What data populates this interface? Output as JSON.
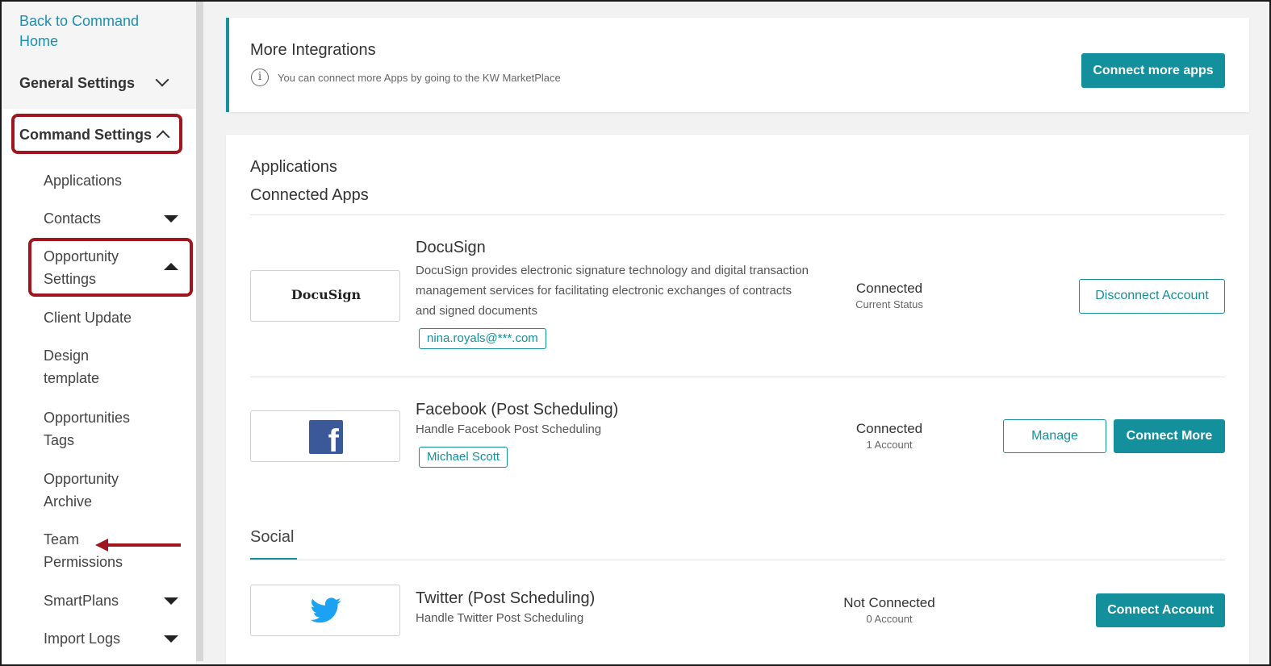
{
  "sidebar": {
    "back_link": "Back to Command Home",
    "general_settings": "General Settings",
    "command_settings": "Command Settings",
    "items": [
      {
        "label": "Applications"
      },
      {
        "label": "Contacts"
      },
      {
        "label": "Opportunity Settings"
      },
      {
        "label": "Client Update"
      },
      {
        "label": "Design template"
      },
      {
        "label": "Opportunities Tags"
      },
      {
        "label": "Opportunity Archive"
      },
      {
        "label": "Team Permissions"
      },
      {
        "label": "SmartPlans"
      },
      {
        "label": "Import Logs"
      }
    ]
  },
  "integrations": {
    "title": "More Integrations",
    "hint": "You can connect more Apps by going to the KW MarketPlace",
    "button": "Connect more apps"
  },
  "applications": {
    "title": "Applications",
    "subtitle": "Connected Apps",
    "apps": [
      {
        "name": "DocuSign",
        "logo_text": "DocuSign",
        "description": "DocuSign provides electronic signature technology and digital transaction management services for facilitating electronic exchanges of contracts and signed documents",
        "account": "nina.royals@***.com",
        "status": "Connected",
        "status_sub": "Current Status",
        "action": "Disconnect Account"
      },
      {
        "name": "Facebook (Post Scheduling)",
        "logo_text": "f",
        "description": "Handle Facebook Post Scheduling",
        "account": "Michael Scott",
        "status": "Connected",
        "status_sub": "1 Account",
        "action_secondary": "Manage",
        "action": "Connect More"
      }
    ],
    "social_tab": "Social",
    "social_apps": [
      {
        "name": "Twitter (Post Scheduling)",
        "description": "Handle Twitter Post Scheduling",
        "status": "Not Connected",
        "status_sub": "0 Account",
        "action": "Connect Account"
      }
    ]
  },
  "colors": {
    "teal": "#13909c",
    "link": "#1b8fb0",
    "annotation_red": "#a0161e",
    "facebook_blue": "#3b5998",
    "twitter_blue": "#1da1f2"
  }
}
